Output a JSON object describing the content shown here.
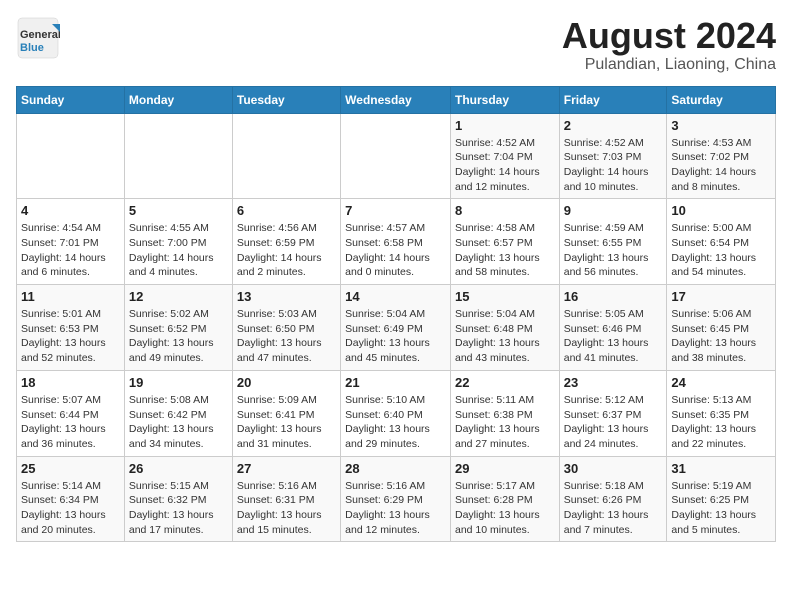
{
  "logo": {
    "text_general": "General",
    "text_blue": "Blue"
  },
  "title": "August 2024",
  "subtitle": "Pulandian, Liaoning, China",
  "days_of_week": [
    "Sunday",
    "Monday",
    "Tuesday",
    "Wednesday",
    "Thursday",
    "Friday",
    "Saturday"
  ],
  "weeks": [
    [
      {
        "day": "",
        "info": ""
      },
      {
        "day": "",
        "info": ""
      },
      {
        "day": "",
        "info": ""
      },
      {
        "day": "",
        "info": ""
      },
      {
        "day": "1",
        "info": "Sunrise: 4:52 AM\nSunset: 7:04 PM\nDaylight: 14 hours and 12 minutes."
      },
      {
        "day": "2",
        "info": "Sunrise: 4:52 AM\nSunset: 7:03 PM\nDaylight: 14 hours and 10 minutes."
      },
      {
        "day": "3",
        "info": "Sunrise: 4:53 AM\nSunset: 7:02 PM\nDaylight: 14 hours and 8 minutes."
      }
    ],
    [
      {
        "day": "4",
        "info": "Sunrise: 4:54 AM\nSunset: 7:01 PM\nDaylight: 14 hours and 6 minutes."
      },
      {
        "day": "5",
        "info": "Sunrise: 4:55 AM\nSunset: 7:00 PM\nDaylight: 14 hours and 4 minutes."
      },
      {
        "day": "6",
        "info": "Sunrise: 4:56 AM\nSunset: 6:59 PM\nDaylight: 14 hours and 2 minutes."
      },
      {
        "day": "7",
        "info": "Sunrise: 4:57 AM\nSunset: 6:58 PM\nDaylight: 14 hours and 0 minutes."
      },
      {
        "day": "8",
        "info": "Sunrise: 4:58 AM\nSunset: 6:57 PM\nDaylight: 13 hours and 58 minutes."
      },
      {
        "day": "9",
        "info": "Sunrise: 4:59 AM\nSunset: 6:55 PM\nDaylight: 13 hours and 56 minutes."
      },
      {
        "day": "10",
        "info": "Sunrise: 5:00 AM\nSunset: 6:54 PM\nDaylight: 13 hours and 54 minutes."
      }
    ],
    [
      {
        "day": "11",
        "info": "Sunrise: 5:01 AM\nSunset: 6:53 PM\nDaylight: 13 hours and 52 minutes."
      },
      {
        "day": "12",
        "info": "Sunrise: 5:02 AM\nSunset: 6:52 PM\nDaylight: 13 hours and 49 minutes."
      },
      {
        "day": "13",
        "info": "Sunrise: 5:03 AM\nSunset: 6:50 PM\nDaylight: 13 hours and 47 minutes."
      },
      {
        "day": "14",
        "info": "Sunrise: 5:04 AM\nSunset: 6:49 PM\nDaylight: 13 hours and 45 minutes."
      },
      {
        "day": "15",
        "info": "Sunrise: 5:04 AM\nSunset: 6:48 PM\nDaylight: 13 hours and 43 minutes."
      },
      {
        "day": "16",
        "info": "Sunrise: 5:05 AM\nSunset: 6:46 PM\nDaylight: 13 hours and 41 minutes."
      },
      {
        "day": "17",
        "info": "Sunrise: 5:06 AM\nSunset: 6:45 PM\nDaylight: 13 hours and 38 minutes."
      }
    ],
    [
      {
        "day": "18",
        "info": "Sunrise: 5:07 AM\nSunset: 6:44 PM\nDaylight: 13 hours and 36 minutes."
      },
      {
        "day": "19",
        "info": "Sunrise: 5:08 AM\nSunset: 6:42 PM\nDaylight: 13 hours and 34 minutes."
      },
      {
        "day": "20",
        "info": "Sunrise: 5:09 AM\nSunset: 6:41 PM\nDaylight: 13 hours and 31 minutes."
      },
      {
        "day": "21",
        "info": "Sunrise: 5:10 AM\nSunset: 6:40 PM\nDaylight: 13 hours and 29 minutes."
      },
      {
        "day": "22",
        "info": "Sunrise: 5:11 AM\nSunset: 6:38 PM\nDaylight: 13 hours and 27 minutes."
      },
      {
        "day": "23",
        "info": "Sunrise: 5:12 AM\nSunset: 6:37 PM\nDaylight: 13 hours and 24 minutes."
      },
      {
        "day": "24",
        "info": "Sunrise: 5:13 AM\nSunset: 6:35 PM\nDaylight: 13 hours and 22 minutes."
      }
    ],
    [
      {
        "day": "25",
        "info": "Sunrise: 5:14 AM\nSunset: 6:34 PM\nDaylight: 13 hours and 20 minutes."
      },
      {
        "day": "26",
        "info": "Sunrise: 5:15 AM\nSunset: 6:32 PM\nDaylight: 13 hours and 17 minutes."
      },
      {
        "day": "27",
        "info": "Sunrise: 5:16 AM\nSunset: 6:31 PM\nDaylight: 13 hours and 15 minutes."
      },
      {
        "day": "28",
        "info": "Sunrise: 5:16 AM\nSunset: 6:29 PM\nDaylight: 13 hours and 12 minutes."
      },
      {
        "day": "29",
        "info": "Sunrise: 5:17 AM\nSunset: 6:28 PM\nDaylight: 13 hours and 10 minutes."
      },
      {
        "day": "30",
        "info": "Sunrise: 5:18 AM\nSunset: 6:26 PM\nDaylight: 13 hours and 7 minutes."
      },
      {
        "day": "31",
        "info": "Sunrise: 5:19 AM\nSunset: 6:25 PM\nDaylight: 13 hours and 5 minutes."
      }
    ]
  ]
}
